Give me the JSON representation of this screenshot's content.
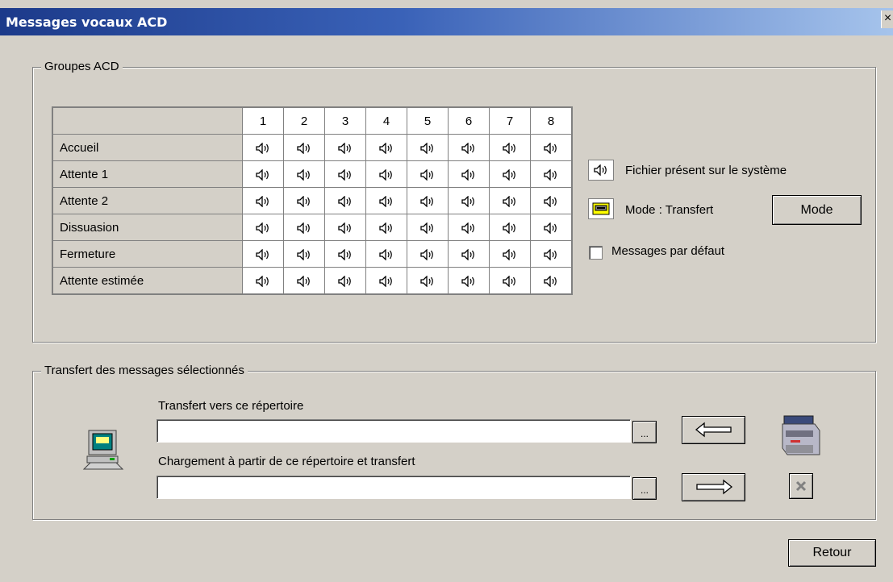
{
  "window": {
    "title": "Messages vocaux ACD",
    "close_glyph": "×"
  },
  "groupes": {
    "legend": "Groupes ACD",
    "columns": [
      "1",
      "2",
      "3",
      "4",
      "5",
      "6",
      "7",
      "8"
    ],
    "rows": [
      "Accueil",
      "Attente 1",
      "Attente 2",
      "Dissuasion",
      "Fermeture",
      "Attente estimée"
    ],
    "cell_icon": "speaker-icon",
    "legend_file_label": "Fichier présent sur le système",
    "mode_label": "Mode : Transfert",
    "mode_button": "Mode",
    "default_checkbox_label": "Messages par défaut",
    "default_checked": false
  },
  "transfert": {
    "legend": "Transfert des messages sélectionnés",
    "dest_label": "Transfert vers ce répertoire",
    "dest_value": "",
    "browse_label": "...",
    "load_label": "Chargement à partir de ce répertoire et transfert",
    "load_value": ""
  },
  "footer": {
    "retour_button": "Retour"
  },
  "colors": {
    "title_start": "#1c3a8a",
    "title_end": "#a6c4ec",
    "face": "#d4d0c8"
  }
}
